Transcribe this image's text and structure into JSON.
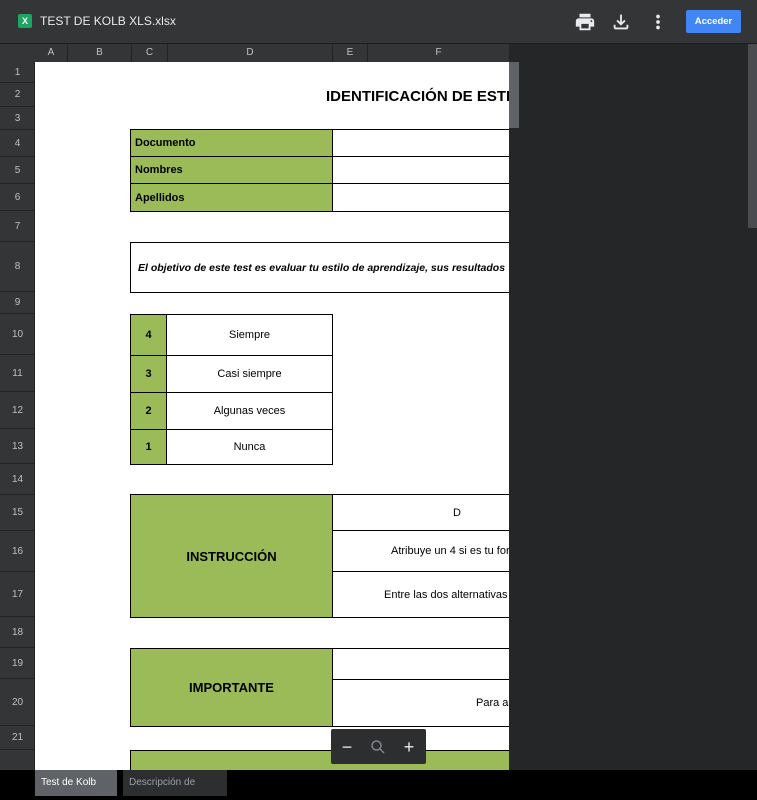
{
  "file": {
    "title": "TEST DE KOLB XLS.xlsx",
    "icon_letter": "X"
  },
  "toolbar": {
    "print_icon": "print-icon",
    "download_icon": "download-icon",
    "more_icon": "more-vert-icon",
    "sign_in_label": "Acceder"
  },
  "columns": [
    "A",
    "B",
    "C",
    "D",
    "E",
    "F"
  ],
  "rows": [
    "1",
    "2",
    "3",
    "4",
    "5",
    "6",
    "7",
    "8",
    "9",
    "10",
    "11",
    "12",
    "13",
    "14",
    "15",
    "16",
    "17",
    "18",
    "19",
    "20",
    "21"
  ],
  "sheet": {
    "heading": "IDENTIFICACIÓN DE ESTI",
    "fields": [
      "Documento",
      "Nombres",
      "Apellidos"
    ],
    "objective": "El objetivo de este test es evaluar tu estilo de aprendizaje, sus resultados",
    "scale": [
      {
        "value": "4",
        "label": "Siempre"
      },
      {
        "value": "3",
        "label": "Casi siempre"
      },
      {
        "value": "2",
        "label": "Algunas veces"
      },
      {
        "value": "1",
        "label": "Nunca"
      }
    ],
    "instruction": {
      "title": "INSTRUCCIÓN",
      "lines": [
        "D",
        "Atribuye un 4 si es tu for",
        "Entre las dos alternativas"
      ]
    },
    "important": {
      "title": "IMPORTANTE",
      "lines": [
        "",
        "Para as"
      ]
    }
  },
  "zoom": {
    "minus": "−",
    "plus": "+"
  },
  "tabs": [
    {
      "label": "Test de Kolb",
      "active": true
    },
    {
      "label": "Descripción de estilos",
      "active": false
    }
  ],
  "colors": {
    "accent": "#4285f4",
    "header_green": "#9bbb59",
    "excel_green": "#1fa463"
  }
}
